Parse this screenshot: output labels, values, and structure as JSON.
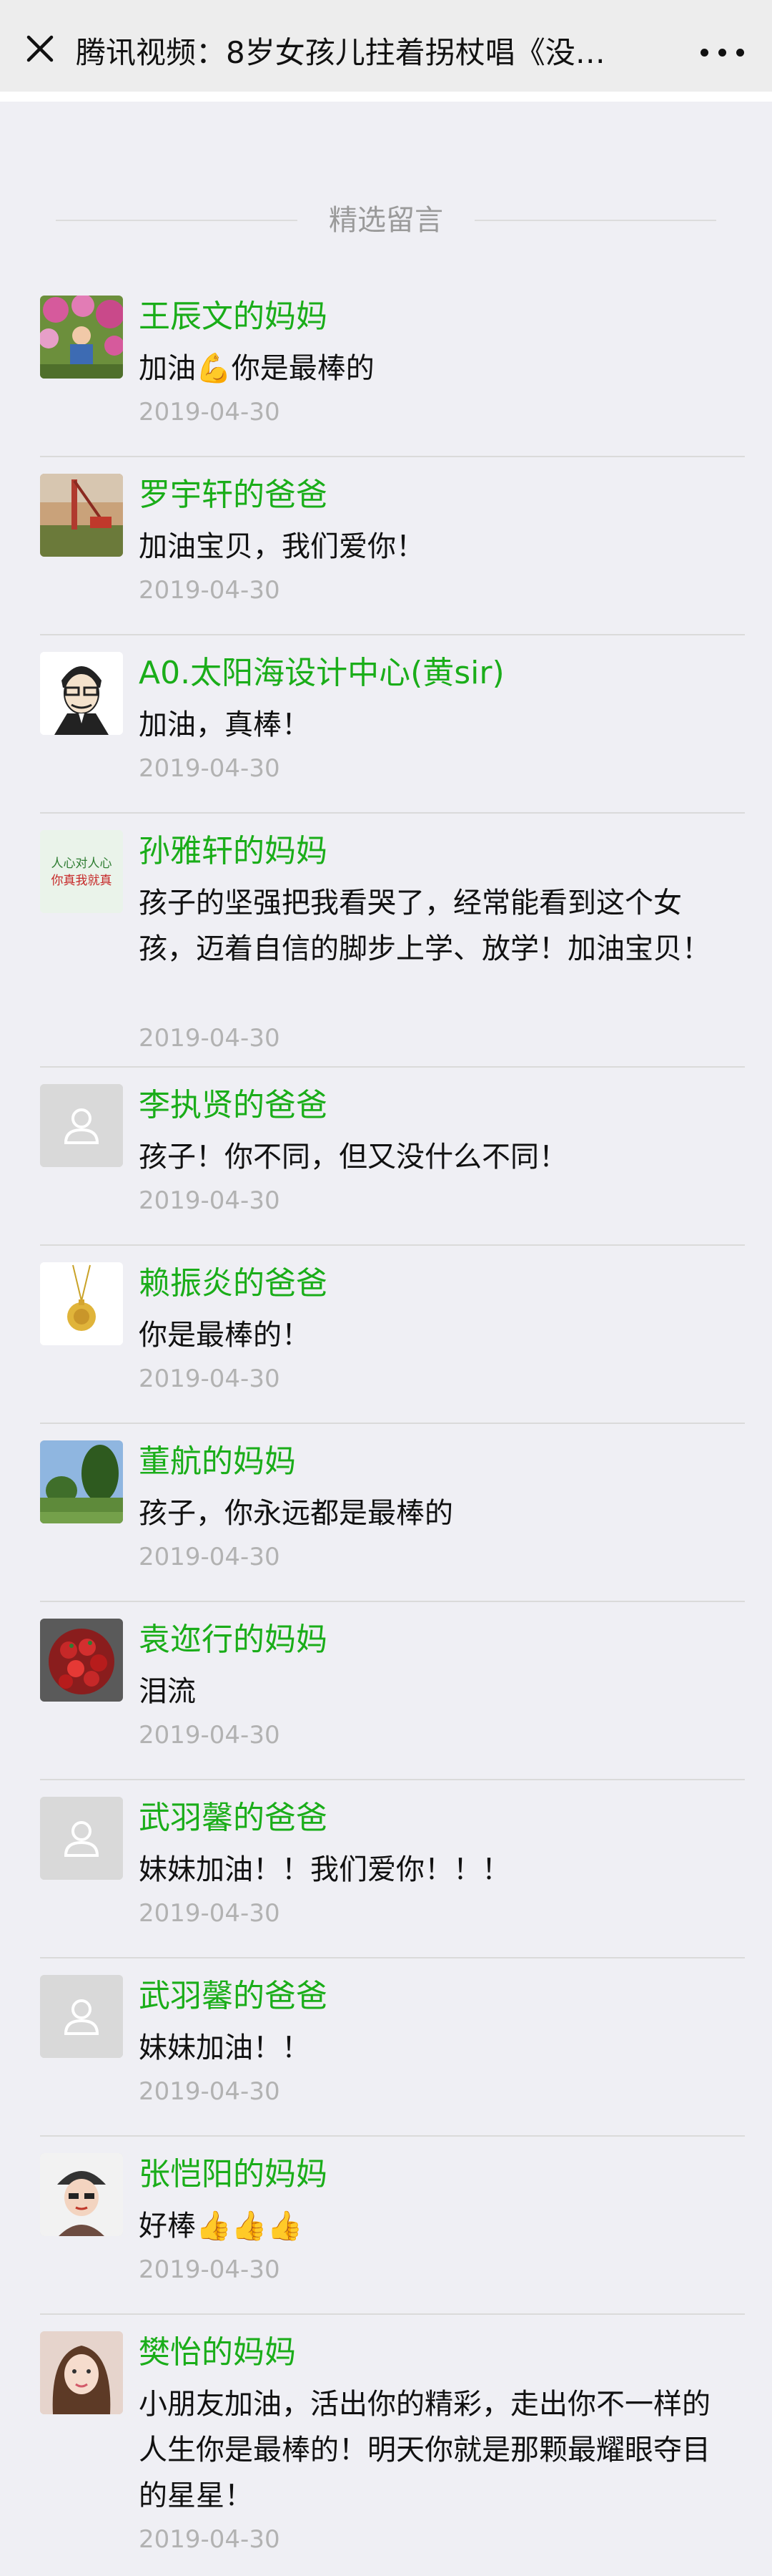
{
  "topbar": {
    "title": "腾讯视频：8岁女孩儿拄着拐杖唱《没…"
  },
  "section": {
    "label": "精选留言"
  },
  "comments": [
    {
      "name": "王辰文的妈妈",
      "text": "加油💪你是最棒的",
      "date": "2019-04-30",
      "avatar": "flower-photo-avatar"
    },
    {
      "name": "罗宇轩的爸爸",
      "text": "加油宝贝，我们爱你！",
      "date": "2019-04-30",
      "avatar": "construction-rig-avatar"
    },
    {
      "name": "A0.太阳海设计中心(黄sir)",
      "text": "加油，真棒！",
      "date": "2019-04-30",
      "avatar": "cartoon-man-avatar"
    },
    {
      "name": "孙雅轩的妈妈",
      "text": "孩子的坚强把我看哭了，经常能看到这个女孩，迈着自信的脚步上学、放学！加油宝贝！",
      "date": "2019-04-30",
      "avatar": "calligraphy-avatar",
      "avatar_text_1": "人心对人心",
      "avatar_text_2": "你真我就真"
    },
    {
      "name": "李执贤的爸爸",
      "text": "孩子！你不同，但又没什么不同！",
      "date": "2019-04-30",
      "avatar": "default-user-avatar"
    },
    {
      "name": "赖振炎的爸爸",
      "text": "你是最棒的！",
      "date": "2019-04-30",
      "avatar": "gold-pendant-avatar"
    },
    {
      "name": "董航的妈妈",
      "text": "孩子，你永远都是最棒的",
      "date": "2019-04-30",
      "avatar": "landscape-avatar"
    },
    {
      "name": "袁迩行的妈妈",
      "text": "泪流",
      "date": "2019-04-30",
      "avatar": "strawberries-avatar"
    },
    {
      "name": "武羽馨的爸爸",
      "text": "妹妹加油！！我们爱你！！！",
      "date": "2019-04-30",
      "avatar": "default-user-avatar"
    },
    {
      "name": "武羽馨的爸爸",
      "text": "妹妹加油！！",
      "date": "2019-04-30",
      "avatar": "default-user-avatar"
    },
    {
      "name": "张恺阳的妈妈",
      "text": "好棒👍👍👍",
      "date": "2019-04-30",
      "avatar": "woman-cap-avatar"
    },
    {
      "name": "樊怡的妈妈",
      "text": "小朋友加油，活出你的精彩，走出你不一样的人生你是最棒的！明天你就是那颗最耀眼夺目的星星！",
      "date": "2019-04-30",
      "avatar": "woman-portrait-avatar"
    }
  ],
  "colors": {
    "name": "#1aad19",
    "date": "#b2b2b2",
    "background": "#efeff4"
  }
}
